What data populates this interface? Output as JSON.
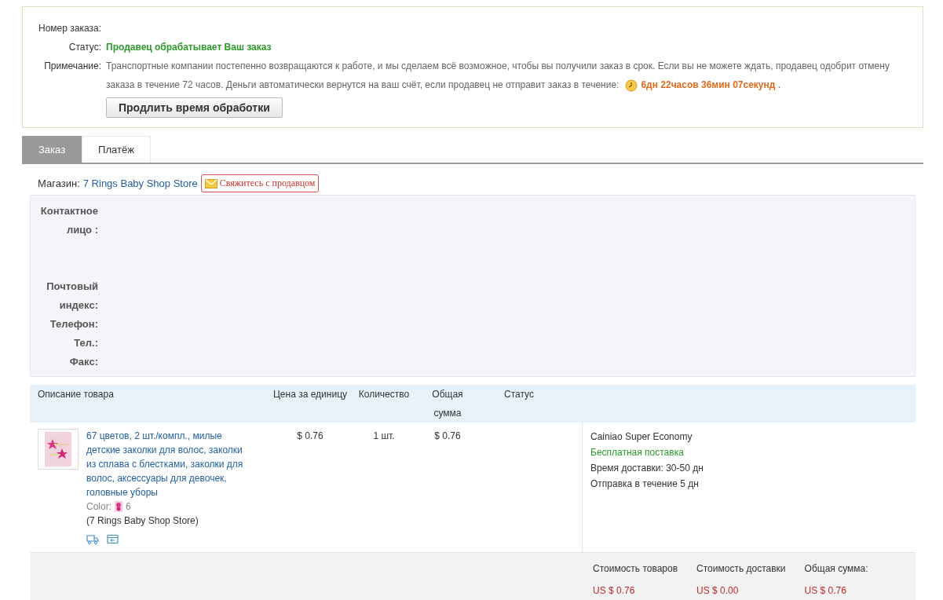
{
  "order": {
    "number_label": "Номер заказа:",
    "status_label": "Статус:",
    "status": "Продавец обрабатывает Ваш заказ",
    "note_label": "Примечание:",
    "note_lines": [
      "Транспортные компании постепенно возвращаются к работе, и мы сделаем всё возможное, чтобы вы получили заказ в срок. Если вы не можете ждать, продавец одобрит отмену",
      "заказа в течение 72 часов. Деньги автоматически вернутся на ваш счёт, если продавец не отправит заказ в течение:"
    ],
    "countdown": "6дн 22часов 36мин 07секунд",
    "note_end": ".",
    "extend_button": "Продлить время обработки"
  },
  "tabs": [
    {
      "label": "Заказ",
      "selected": true
    },
    {
      "label": "Платёж",
      "selected": false
    }
  ],
  "store": {
    "label": "Магазин:",
    "name": "7 Rings Baby Shop Store",
    "contact_button": "Свяжитесь с продавцом"
  },
  "address": {
    "fields": [
      "Контактное лицо :",
      "Почтовый индекс:",
      "Телефон:",
      "Тел.:",
      "Факс:"
    ]
  },
  "table": {
    "columns": [
      "Описание товара",
      "Цена за единицу",
      "Количество",
      "Общая сумма",
      "Статус"
    ],
    "rows": [
      {
        "title": "67 цветов, 2 шт./компл., милые детские заколки для волос, заколки из сплава с блестками, заколки для волос, аксессуары для девочек, головные уборы",
        "color_label": "Color:",
        "color_value": "6",
        "store": "(7 Rings Baby Shop Store)",
        "price": "$ 0.76",
        "quantity": "1 шт.",
        "total": "$ 0.76",
        "shipping": {
          "method": "Cainiao Super Economy",
          "cost": "Бесплатная поставка",
          "time_label": "Время доставки:",
          "time": "30-50 дн",
          "dispatch_label": "Отправка в течение",
          "dispatch": "5 дн"
        }
      }
    ]
  },
  "totals": [
    {
      "label": "Стоимость товаров",
      "value": "US $ 0.76"
    },
    {
      "label": "Стоимость доставки",
      "value": "US $ 0.00"
    },
    {
      "label": "Общая сумма:",
      "value": "US $ 0.76"
    }
  ]
}
